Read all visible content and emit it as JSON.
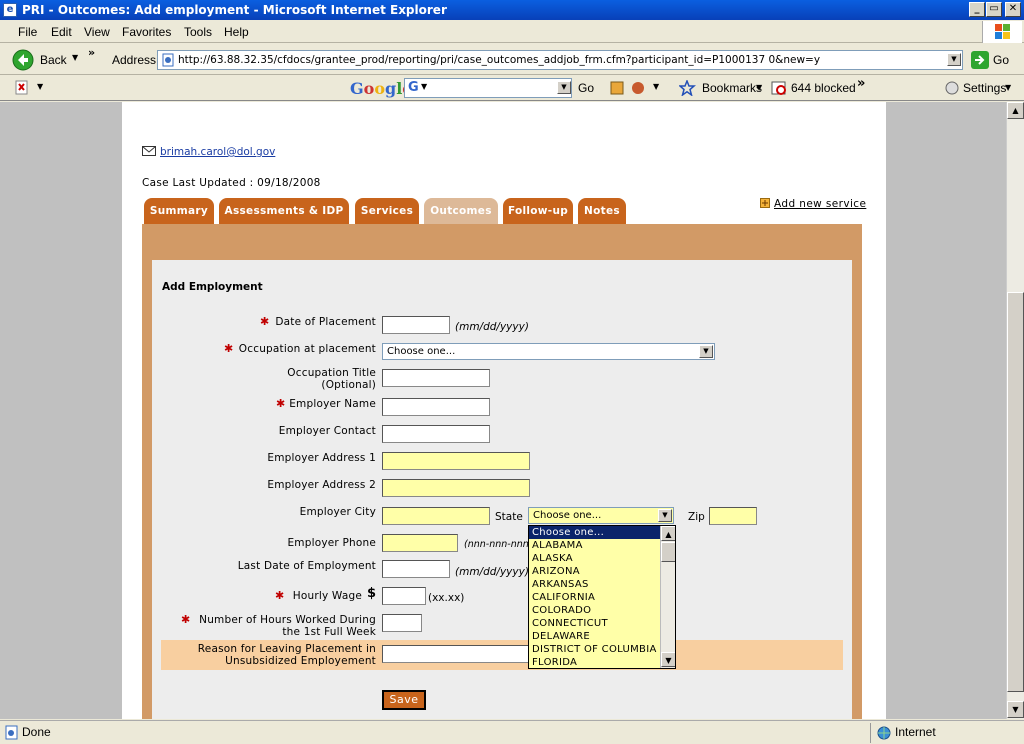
{
  "window": {
    "title": "PRI - Outcomes: Add employment - Microsoft Internet Explorer",
    "controls": [
      "_",
      "▭",
      "✕"
    ]
  },
  "menu": [
    "File",
    "Edit",
    "View",
    "Favorites",
    "Tools",
    "Help"
  ],
  "toolbar": {
    "back": "Back",
    "address_label": "Address",
    "url": "http://63.88.32.35/cfdocs/grantee_prod/reporting/pri/case_outcomes_addjob_frm.cfm?participant_id=P1000137 0&new=y",
    "go": "Go"
  },
  "google": {
    "logo": "Google",
    "go": "Go",
    "bookmarks": "Bookmarks",
    "blocked": "644 blocked",
    "settings": "Settings"
  },
  "page": {
    "email": "brimah.carol@dol.gov",
    "case_updated": "Case Last Updated : 09/18/2008",
    "tabs": [
      "Summary",
      "Assessments & IDP",
      "Services",
      "Outcomes",
      "Follow-up",
      "Notes"
    ],
    "add_service": "Add new service",
    "section_title": "Add Employment",
    "fields": {
      "date_placement": "Date of Placement",
      "date_hint": "(mm/dd/yyyy)",
      "occupation": "Occupation at placement",
      "occupation_value": "Choose one...",
      "occ_title": "Occupation Title",
      "optional": "(Optional)",
      "employer_name": "Employer Name",
      "employer_contact": "Employer Contact",
      "addr1": "Employer Address 1",
      "addr2": "Employer Address 2",
      "city": "Employer City",
      "state": "State",
      "state_value": "Choose one...",
      "zip": "Zip",
      "phone": "Employer Phone",
      "phone_hint": "(nnn-nnn-nnn",
      "last_date": "Last Date of Employment",
      "last_date_hint": "(mm/dd/yyyy)",
      "wage": "Hourly Wage",
      "dollar": "$",
      "wage_hint": "(xx.xx)",
      "hours1": "Number of Hours Worked During",
      "hours2": "the 1st  Full Week",
      "reason1": "Reason for Leaving Placement in",
      "reason2": "Unsubsidized Employement",
      "required_mark": "✱"
    },
    "state_options": [
      "Choose one...",
      "ALABAMA",
      "ALASKA",
      "ARIZONA",
      "ARKANSAS",
      "CALIFORNIA",
      "COLORADO",
      "CONNECTICUT",
      "DELAWARE",
      "DISTRICT OF COLUMBIA",
      "FLORIDA"
    ],
    "save": "Save"
  },
  "status": {
    "text": "Done",
    "zone": "Internet"
  }
}
